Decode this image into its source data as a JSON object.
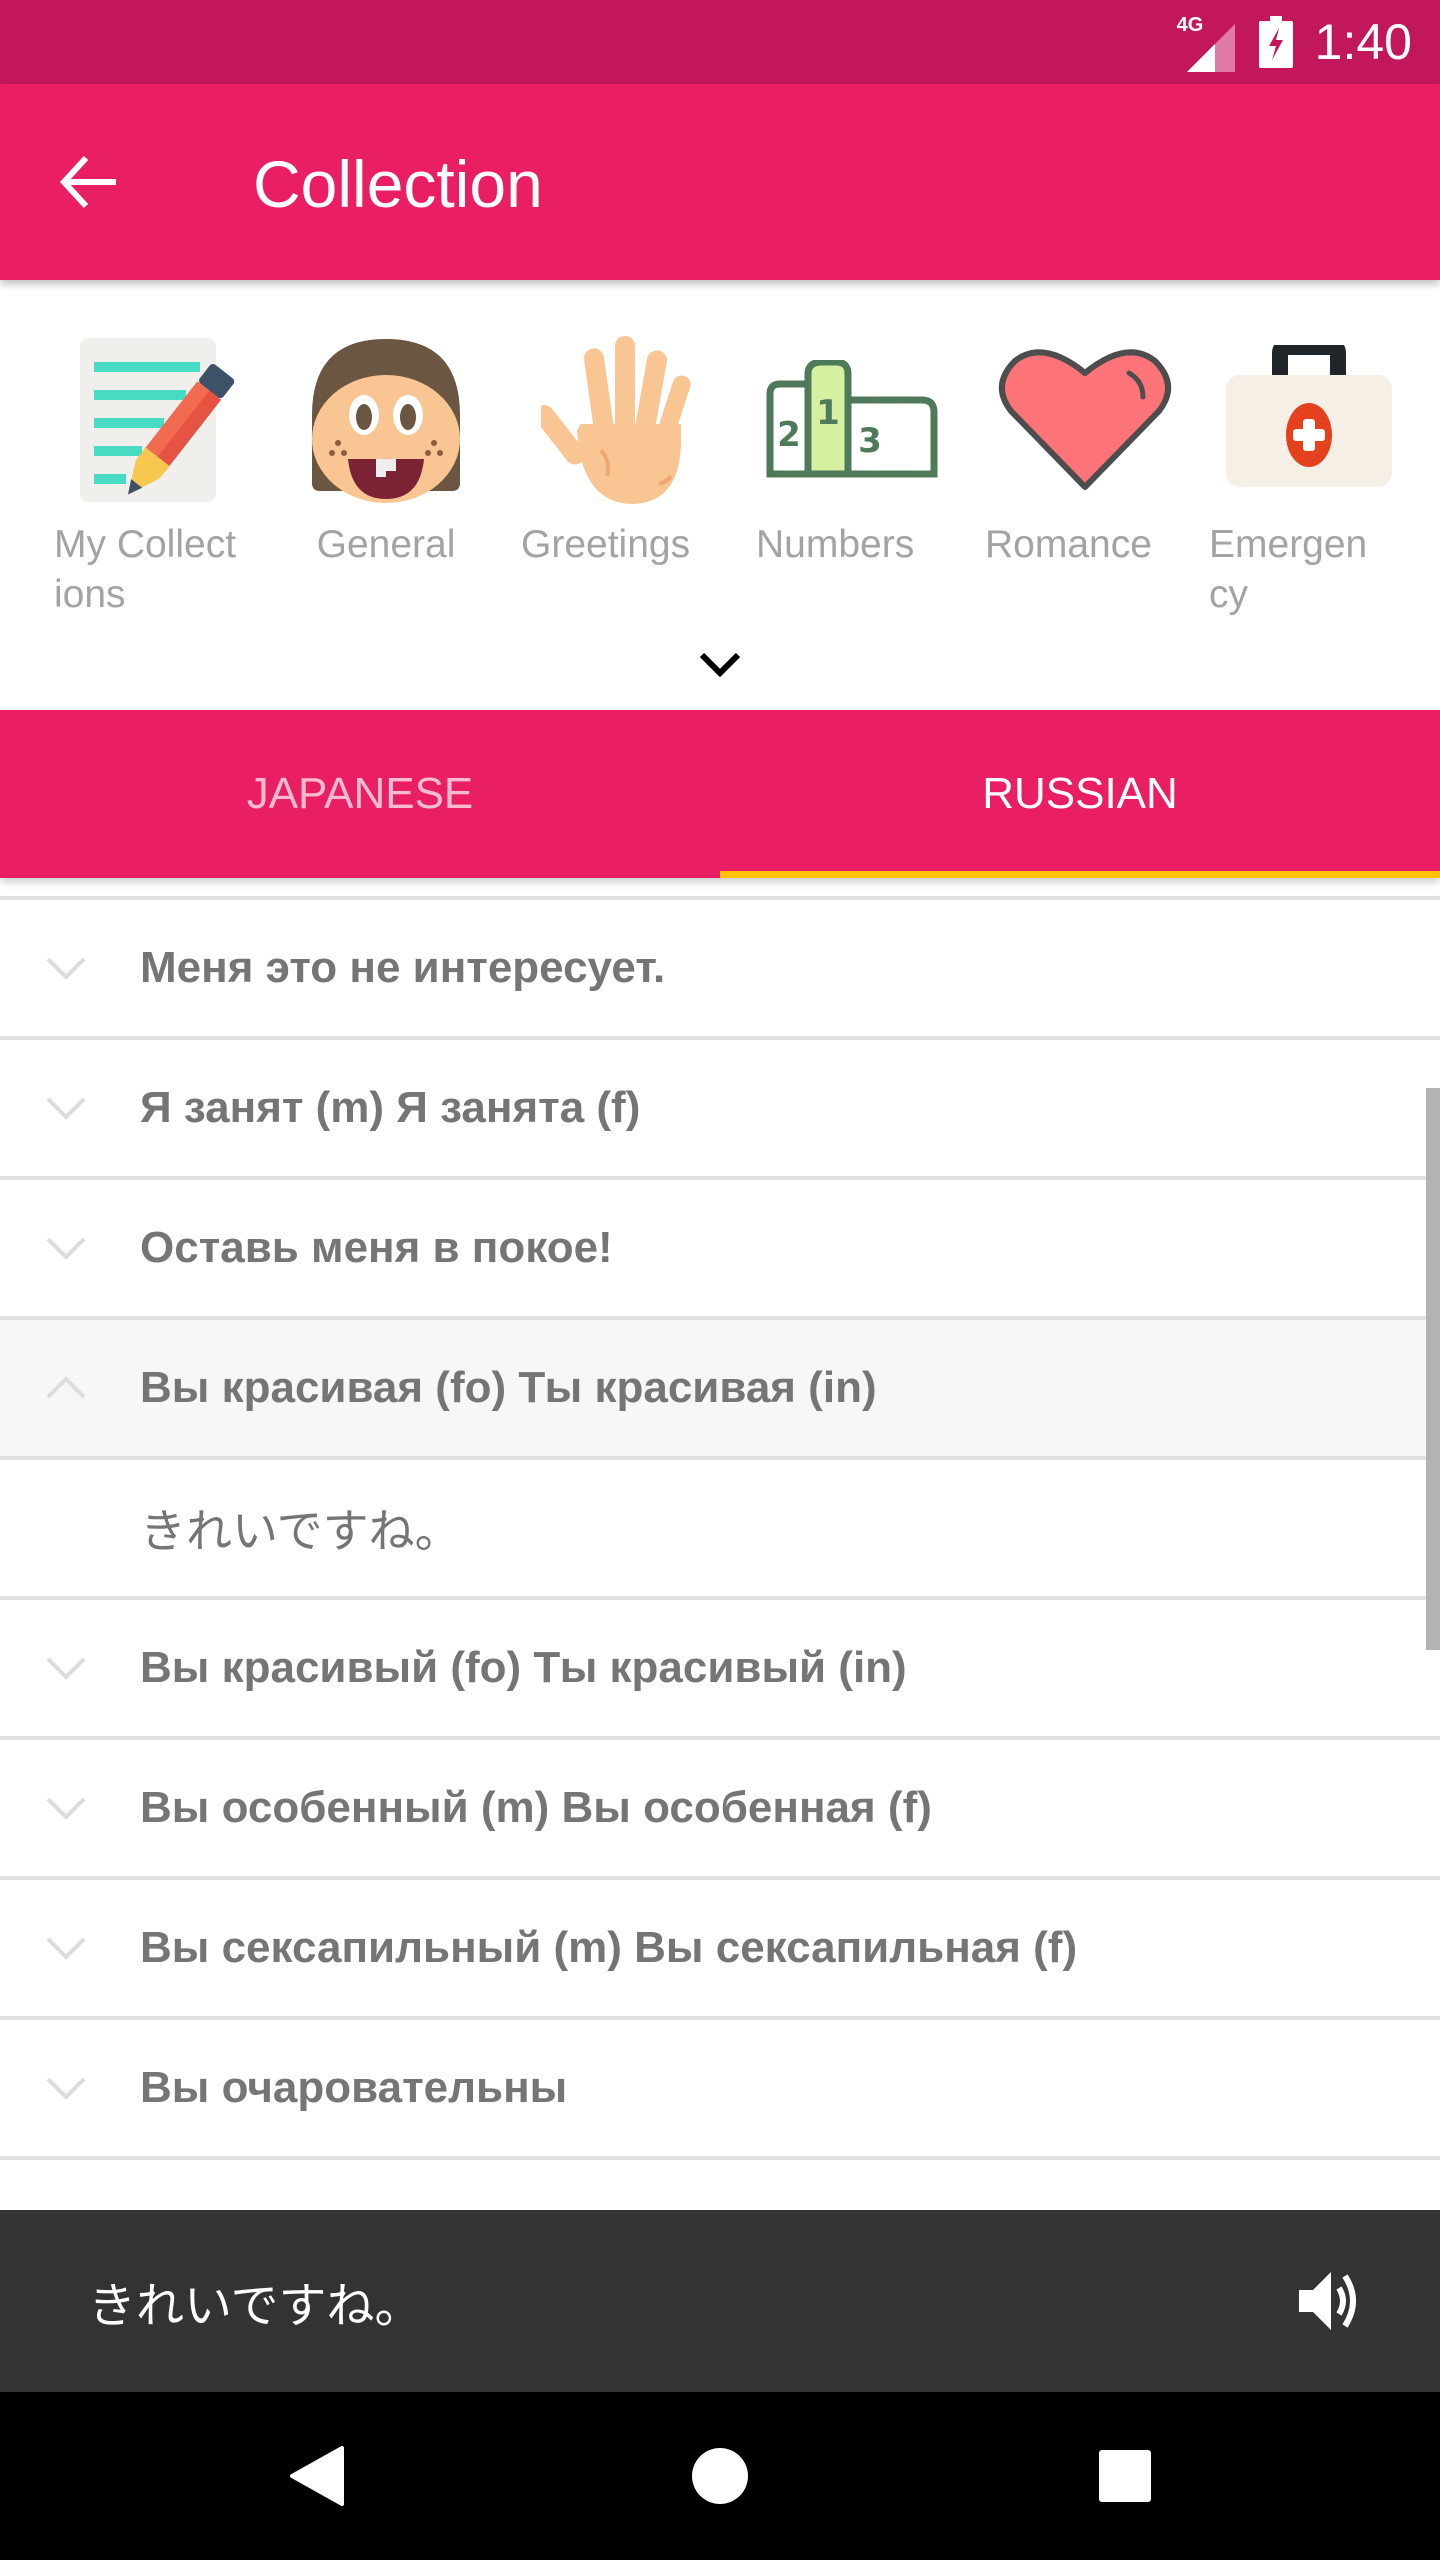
{
  "status_bar": {
    "network": "4G",
    "signal_icon": "cell-signal-icon",
    "battery_icon": "battery-charging-icon",
    "time": "1:40",
    "colors": {
      "background": "#c2185b"
    }
  },
  "app_bar": {
    "back_icon": "arrow-back-icon",
    "title": "Collection",
    "colors": {
      "background": "#e91e63",
      "text": "#ffffff"
    }
  },
  "categories": {
    "items": [
      {
        "label": "My Collect\nions",
        "icon": "notepad-pencil-icon"
      },
      {
        "label": "General",
        "icon": "girl-face-icon"
      },
      {
        "label": "Greetings",
        "icon": "waving-hand-icon"
      },
      {
        "label": "Numbers",
        "icon": "podium-icon"
      },
      {
        "label": "Romance",
        "icon": "heart-icon"
      },
      {
        "label": "Emergen\ncy",
        "icon": "first-aid-kit-icon"
      }
    ],
    "expand_icon": "chevron-down-icon"
  },
  "tabs": {
    "items": [
      {
        "label": "JAPANESE",
        "selected": false
      },
      {
        "label": "RUSSIAN",
        "selected": true
      }
    ],
    "colors": {
      "background": "#e91e63",
      "indicator": "#ffc107",
      "inactive_text": "#f8bbd0",
      "active_text": "#ffffff"
    }
  },
  "phrases": {
    "items": [
      {
        "text": "Меня это не интересует.",
        "expanded": false
      },
      {
        "text": "Я занят (m)  Я занята (f)",
        "expanded": false
      },
      {
        "text": "Оставь меня в покое!",
        "expanded": false
      },
      {
        "text": "Вы красивая (fo)  Ты красивая (in)",
        "expanded": true,
        "translation": "きれいですね。"
      },
      {
        "text": "Вы красивый (fo)  Ты красивый (in)",
        "expanded": false
      },
      {
        "text": "Вы особенный (m)  Вы особенная (f)",
        "expanded": false
      },
      {
        "text": "Вы сексапильный (m)  Вы сексапильная (f)",
        "expanded": false
      },
      {
        "text": "Вы очаровательны",
        "expanded": false
      }
    ]
  },
  "player": {
    "text": "きれいですね。",
    "speaker_icon": "volume-up-icon",
    "colors": {
      "background": "#333333"
    }
  },
  "nav_bar": {
    "back_icon": "nav-back-icon",
    "home_icon": "nav-home-icon",
    "recents_icon": "nav-recents-icon"
  }
}
